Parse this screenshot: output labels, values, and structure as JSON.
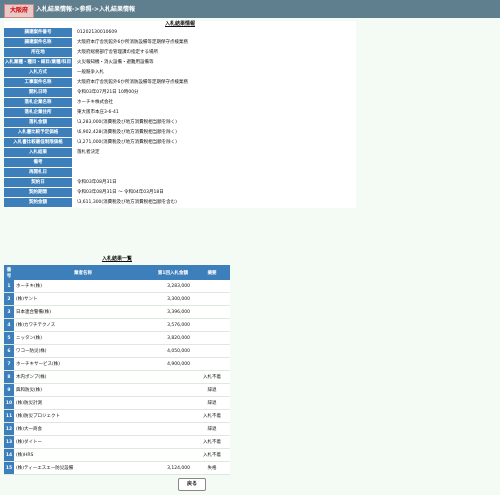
{
  "header": {
    "logo": "大阪府",
    "breadcrumb": "入札結果情報->参照->入札結果情報"
  },
  "detail": {
    "title": "入札結果情報",
    "rows": [
      {
        "label": "調達案件番号",
        "value": "01202130010609"
      },
      {
        "label": "調達案件名称",
        "value": "大阪府本庁舎別館外6か所消防設備等定期保守点検業務"
      },
      {
        "label": "所在地",
        "value": "大阪府総務部庁舎管理課の指定する場所"
      },
      {
        "label": "入札業種・種目・細目/業種/科目",
        "value": "火災報知機・消火設備・避難用設備等"
      },
      {
        "label": "入札方式",
        "value": "一般競争入札"
      },
      {
        "label": "工事案件名称",
        "value": "大阪府本庁舎別館外6か所消防設備等定期保守点検業務"
      },
      {
        "label": "開札日時",
        "value": "令和03年07月21日 10時00分"
      },
      {
        "label": "落札企業名称",
        "value": "ホーチキ株式会社"
      },
      {
        "label": "落札企業住所",
        "value": "東大阪市本庄3-6-41"
      },
      {
        "label": "落札金額",
        "value": "\\3,283,000(消費税及び地方消費税相当額を除く)"
      },
      {
        "label": "入札書比較予定価格",
        "value": "\\6,902,428(消費税及び地方消費税相当額を除く)"
      },
      {
        "label": "入札書比較最低制限価格",
        "value": "\\3,271,000(消費税及び地方消費税相当額を除く)"
      },
      {
        "label": "入札結果",
        "value": "落札者決定"
      },
      {
        "label": "備考",
        "value": ""
      },
      {
        "label": "再開札日",
        "value": ""
      },
      {
        "label": "契約日",
        "value": "令和03年08月31日"
      },
      {
        "label": "契約期間",
        "value": "令和03年08月31日 ～ 令和04年03月18日"
      },
      {
        "label": "契約金額",
        "value": "\\3,611,300(消費税及び地方消費税相当額を含む)"
      }
    ]
  },
  "bid_list": {
    "title": "入札結果一覧",
    "headers": [
      "番号",
      "業者名称",
      "第1回入札金額",
      "摘要"
    ],
    "rows": [
      {
        "no": "1",
        "name": "ホーチキ(株)",
        "amount": "3,283,000",
        "note": ""
      },
      {
        "no": "2",
        "name": "(株)サント",
        "amount": "3,300,000",
        "note": ""
      },
      {
        "no": "3",
        "name": "日本連合警備(株)",
        "amount": "3,396,000",
        "note": ""
      },
      {
        "no": "4",
        "name": "(株)カワチテクノス",
        "amount": "3,576,000",
        "note": ""
      },
      {
        "no": "5",
        "name": "ニッタン(株)",
        "amount": "3,820,000",
        "note": ""
      },
      {
        "no": "6",
        "name": "ワコー防災(株)",
        "amount": "4,050,000",
        "note": ""
      },
      {
        "no": "7",
        "name": "ホーチキサービス(株)",
        "amount": "4,900,000",
        "note": ""
      },
      {
        "no": "8",
        "name": "木内ポンプ(株)",
        "amount": "",
        "note": "入札不着"
      },
      {
        "no": "9",
        "name": "興和防災(株)",
        "amount": "",
        "note": "辞退"
      },
      {
        "no": "10",
        "name": "(株)防災計測",
        "amount": "",
        "note": "辞退"
      },
      {
        "no": "11",
        "name": "(株)防災プロジェクト",
        "amount": "",
        "note": "入札不着"
      },
      {
        "no": "12",
        "name": "(株)大一商会",
        "amount": "",
        "note": "辞退"
      },
      {
        "no": "13",
        "name": "(株)ダイトー",
        "amount": "",
        "note": "入札不着"
      },
      {
        "no": "14",
        "name": "(株)HRS",
        "amount": "",
        "note": "入札不着"
      },
      {
        "no": "15",
        "name": "(株)ティーエスエー防災設備",
        "amount": "3,124,000",
        "note": "失格"
      }
    ]
  },
  "back_label": "戻る"
}
